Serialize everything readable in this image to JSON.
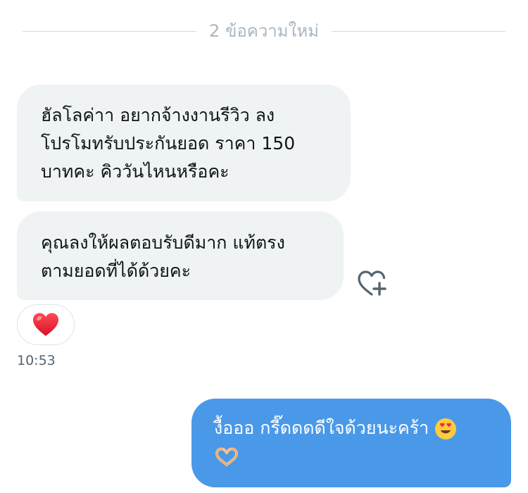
{
  "divider": {
    "text": "2 ข้อความใหม่"
  },
  "messages": [
    {
      "direction": "incoming",
      "lines": [
        "ฮัลโลค่าา อยากจ้างงานรีวิว ลง",
        "โปรโมทรับประกันยอด ราคา 150",
        "บาทคะ คิววันไหนหรือคะ"
      ]
    },
    {
      "direction": "incoming",
      "lines": [
        "คุณลงให้ผลตอบรับดีมาก แท้ตรง",
        "ตามยอดที่ได้ด้วยคะ"
      ]
    },
    {
      "direction": "outgoing",
      "lines": [
        "งื้อออ กรี๊ดดดดีใจด้วยนะคร้า"
      ]
    }
  ],
  "reaction": {
    "icon": "red-heart-emoji"
  },
  "add_reaction": {
    "icon": "heart-plus-icon"
  },
  "timestamp": "10:53",
  "colors": {
    "outgoing_bubble": "#4a99e9",
    "incoming_bubble": "#eff3f4",
    "divider_text": "#a9b6c1",
    "timestamp": "#536471"
  },
  "emojis": [
    "smiling-face-with-heart-eyes-emoji",
    "heart-hands-emoji"
  ]
}
